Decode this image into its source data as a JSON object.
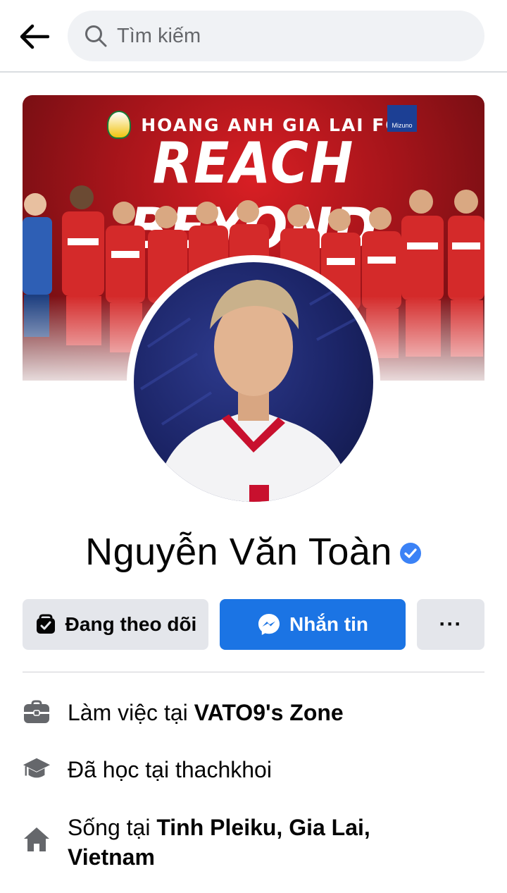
{
  "search": {
    "placeholder": "Tìm kiếm"
  },
  "cover": {
    "club_name": "HOANG ANH GIA LAI FC",
    "title": "REACH BEYOND",
    "sponsor": "Mizuno"
  },
  "profile": {
    "name": "Nguyễn Văn Toàn",
    "verified": true
  },
  "actions": {
    "following_label": "Đang theo dõi",
    "message_label": "Nhắn tin",
    "more_label": "···"
  },
  "intro": {
    "work": {
      "prefix": "Làm việc tại ",
      "value": "VATO9's Zone"
    },
    "education": {
      "prefix": "Đã học tại ",
      "value": "thachkhoi"
    },
    "lives": {
      "prefix": "Sống tại ",
      "value": "Tinh Pleiku, Gia Lai, Vietnam"
    }
  },
  "colors": {
    "accent": "#1b74e4",
    "button_gray": "#e4e6eb",
    "icon_gray": "#65676b",
    "verified_blue": "#3b82f6"
  }
}
